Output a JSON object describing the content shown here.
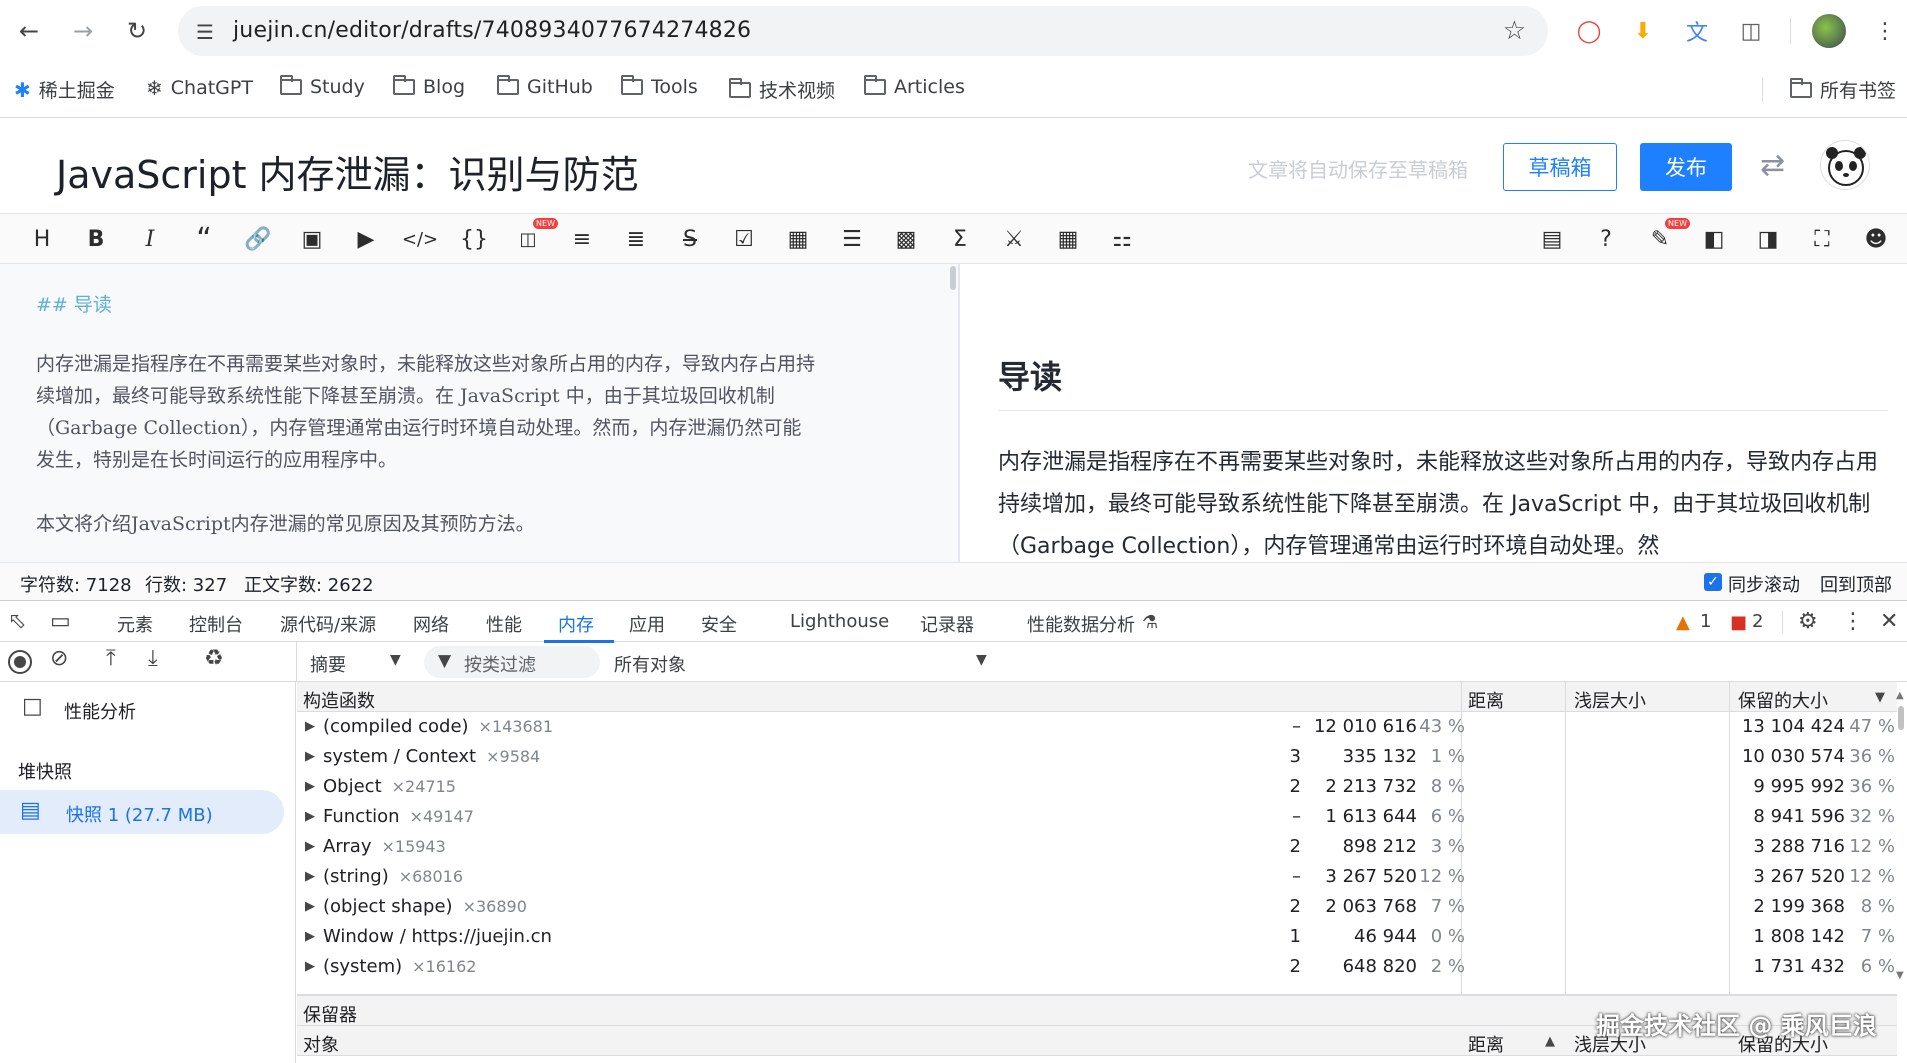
{
  "browser": {
    "url": "juejin.cn/editor/drafts/7408934077674274826",
    "bookmarks": [
      "稀土掘金",
      "ChatGPT",
      "Study",
      "Blog",
      "GitHub",
      "Tools",
      "技术视频",
      "Articles"
    ],
    "all_bookmarks": "所有书签"
  },
  "editor": {
    "title": "JavaScript 内存泄漏：识别与防范",
    "autosave_hint": "文章将自动保存至草稿箱",
    "drafts_label": "草稿箱",
    "publish_label": "发布",
    "new_badge": "NEW",
    "md_heading": "## 导读",
    "md_para1_line1": "内存泄漏是指程序在不再需要某些对象时，未能释放这些对象所占用的内存，导致内存占用持",
    "md_para1_line2": "续增加，最终可能导致系统性能下降甚至崩溃。在 JavaScript 中，由于其垃圾回收机制",
    "md_para1_line3": "（Garbage Collection），内存管理通常由运行时环境自动处理。然而，内存泄漏仍然可能",
    "md_para1_line4": "发生，特别是在长时间运行的应用程序中。",
    "md_para2": "本文将介绍JavaScript内存泄漏的常见原因及其预防方法。",
    "preview_heading": "导读",
    "preview_para": "内存泄漏是指程序在不再需要某些对象时，未能释放这些对象所占用的内存，导致内存占用持续增加，最终可能导致系统性能下降甚至崩溃。在 JavaScript 中，由于其垃圾回收机制（Garbage Collection），内存管理通常由运行时环境自动处理。然"
  },
  "status": {
    "chars": "字符数: 7128",
    "lines": "行数: 327",
    "body_chars": "正文字数: 2622",
    "sync_scroll": "同步滚动",
    "back_to_top": "回到顶部"
  },
  "devtools": {
    "tabs": [
      "元素",
      "控制台",
      "源代码/来源",
      "网络",
      "性能",
      "内存",
      "应用",
      "安全",
      "Lighthouse",
      "记录器",
      "性能数据分析"
    ],
    "warnings": "1",
    "errors": "2",
    "view_select": "摘要",
    "class_filter": "按类过滤",
    "objects_select": "所有对象",
    "profiles_label": "性能分析",
    "heap_snapshots": "堆快照",
    "snapshot_label": "快照 1 (27.7 MB)",
    "columns": {
      "constructor": "构造函数",
      "distance": "距离",
      "shallow": "浅层大小",
      "retained": "保留的大小"
    },
    "rows": [
      {
        "name": "(compiled code)",
        "count": "×143681",
        "distance": "–",
        "shallow": "12 010 616",
        "shallow_pct": "43 %",
        "retained": "13 104 424",
        "retained_pct": "47 %"
      },
      {
        "name": "system / Context",
        "count": "×9584",
        "distance": "3",
        "shallow": "335 132",
        "shallow_pct": "1 %",
        "retained": "10 030 574",
        "retained_pct": "36 %"
      },
      {
        "name": "Object",
        "count": "×24715",
        "distance": "2",
        "shallow": "2 213 732",
        "shallow_pct": "8 %",
        "retained": "9 995 992",
        "retained_pct": "36 %"
      },
      {
        "name": "Function",
        "count": "×49147",
        "distance": "–",
        "shallow": "1 613 644",
        "shallow_pct": "6 %",
        "retained": "8 941 596",
        "retained_pct": "32 %"
      },
      {
        "name": "Array",
        "count": "×15943",
        "distance": "2",
        "shallow": "898 212",
        "shallow_pct": "3 %",
        "retained": "3 288 716",
        "retained_pct": "12 %"
      },
      {
        "name": "(string)",
        "count": "×68016",
        "distance": "–",
        "shallow": "3 267 520",
        "shallow_pct": "12 %",
        "retained": "3 267 520",
        "retained_pct": "12 %"
      },
      {
        "name": "(object shape)",
        "count": "×36890",
        "distance": "2",
        "shallow": "2 063 768",
        "shallow_pct": "7 %",
        "retained": "2 199 368",
        "retained_pct": "8 %"
      },
      {
        "name": "Window / https://juejin.cn",
        "count": "",
        "distance": "1",
        "shallow": "46 944",
        "shallow_pct": "0 %",
        "retained": "1 808 142",
        "retained_pct": "7 %"
      },
      {
        "name": "(system)",
        "count": "×16162",
        "distance": "2",
        "shallow": "648 820",
        "shallow_pct": "2 %",
        "retained": "1 731 432",
        "retained_pct": "6 %"
      }
    ],
    "retainers_label": "保留器",
    "retainers_columns": {
      "object": "对象",
      "distance": "距离",
      "shallow": "浅层大小",
      "retained": "保留的大小"
    },
    "watermark": "掘金技术社区 @ 乘风巨浪"
  }
}
